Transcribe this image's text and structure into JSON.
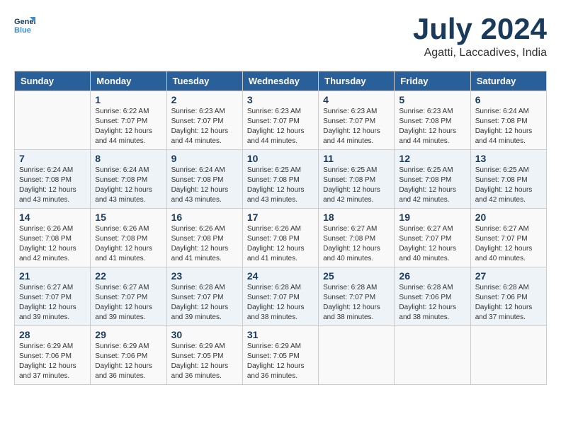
{
  "header": {
    "logo_line1": "General",
    "logo_line2": "Blue",
    "month_year": "July 2024",
    "subtitle": "Agatti, Laccadives, India"
  },
  "columns": [
    "Sunday",
    "Monday",
    "Tuesday",
    "Wednesday",
    "Thursday",
    "Friday",
    "Saturday"
  ],
  "weeks": [
    [
      {
        "day": "",
        "info": ""
      },
      {
        "day": "1",
        "info": "Sunrise: 6:22 AM\nSunset: 7:07 PM\nDaylight: 12 hours\nand 44 minutes."
      },
      {
        "day": "2",
        "info": "Sunrise: 6:23 AM\nSunset: 7:07 PM\nDaylight: 12 hours\nand 44 minutes."
      },
      {
        "day": "3",
        "info": "Sunrise: 6:23 AM\nSunset: 7:07 PM\nDaylight: 12 hours\nand 44 minutes."
      },
      {
        "day": "4",
        "info": "Sunrise: 6:23 AM\nSunset: 7:07 PM\nDaylight: 12 hours\nand 44 minutes."
      },
      {
        "day": "5",
        "info": "Sunrise: 6:23 AM\nSunset: 7:08 PM\nDaylight: 12 hours\nand 44 minutes."
      },
      {
        "day": "6",
        "info": "Sunrise: 6:24 AM\nSunset: 7:08 PM\nDaylight: 12 hours\nand 44 minutes."
      }
    ],
    [
      {
        "day": "7",
        "info": "Sunrise: 6:24 AM\nSunset: 7:08 PM\nDaylight: 12 hours\nand 43 minutes."
      },
      {
        "day": "8",
        "info": "Sunrise: 6:24 AM\nSunset: 7:08 PM\nDaylight: 12 hours\nand 43 minutes."
      },
      {
        "day": "9",
        "info": "Sunrise: 6:24 AM\nSunset: 7:08 PM\nDaylight: 12 hours\nand 43 minutes."
      },
      {
        "day": "10",
        "info": "Sunrise: 6:25 AM\nSunset: 7:08 PM\nDaylight: 12 hours\nand 43 minutes."
      },
      {
        "day": "11",
        "info": "Sunrise: 6:25 AM\nSunset: 7:08 PM\nDaylight: 12 hours\nand 42 minutes."
      },
      {
        "day": "12",
        "info": "Sunrise: 6:25 AM\nSunset: 7:08 PM\nDaylight: 12 hours\nand 42 minutes."
      },
      {
        "day": "13",
        "info": "Sunrise: 6:25 AM\nSunset: 7:08 PM\nDaylight: 12 hours\nand 42 minutes."
      }
    ],
    [
      {
        "day": "14",
        "info": "Sunrise: 6:26 AM\nSunset: 7:08 PM\nDaylight: 12 hours\nand 42 minutes."
      },
      {
        "day": "15",
        "info": "Sunrise: 6:26 AM\nSunset: 7:08 PM\nDaylight: 12 hours\nand 41 minutes."
      },
      {
        "day": "16",
        "info": "Sunrise: 6:26 AM\nSunset: 7:08 PM\nDaylight: 12 hours\nand 41 minutes."
      },
      {
        "day": "17",
        "info": "Sunrise: 6:26 AM\nSunset: 7:08 PM\nDaylight: 12 hours\nand 41 minutes."
      },
      {
        "day": "18",
        "info": "Sunrise: 6:27 AM\nSunset: 7:08 PM\nDaylight: 12 hours\nand 40 minutes."
      },
      {
        "day": "19",
        "info": "Sunrise: 6:27 AM\nSunset: 7:07 PM\nDaylight: 12 hours\nand 40 minutes."
      },
      {
        "day": "20",
        "info": "Sunrise: 6:27 AM\nSunset: 7:07 PM\nDaylight: 12 hours\nand 40 minutes."
      }
    ],
    [
      {
        "day": "21",
        "info": "Sunrise: 6:27 AM\nSunset: 7:07 PM\nDaylight: 12 hours\nand 39 minutes."
      },
      {
        "day": "22",
        "info": "Sunrise: 6:27 AM\nSunset: 7:07 PM\nDaylight: 12 hours\nand 39 minutes."
      },
      {
        "day": "23",
        "info": "Sunrise: 6:28 AM\nSunset: 7:07 PM\nDaylight: 12 hours\nand 39 minutes."
      },
      {
        "day": "24",
        "info": "Sunrise: 6:28 AM\nSunset: 7:07 PM\nDaylight: 12 hours\nand 38 minutes."
      },
      {
        "day": "25",
        "info": "Sunrise: 6:28 AM\nSunset: 7:07 PM\nDaylight: 12 hours\nand 38 minutes."
      },
      {
        "day": "26",
        "info": "Sunrise: 6:28 AM\nSunset: 7:06 PM\nDaylight: 12 hours\nand 38 minutes."
      },
      {
        "day": "27",
        "info": "Sunrise: 6:28 AM\nSunset: 7:06 PM\nDaylight: 12 hours\nand 37 minutes."
      }
    ],
    [
      {
        "day": "28",
        "info": "Sunrise: 6:29 AM\nSunset: 7:06 PM\nDaylight: 12 hours\nand 37 minutes."
      },
      {
        "day": "29",
        "info": "Sunrise: 6:29 AM\nSunset: 7:06 PM\nDaylight: 12 hours\nand 36 minutes."
      },
      {
        "day": "30",
        "info": "Sunrise: 6:29 AM\nSunset: 7:05 PM\nDaylight: 12 hours\nand 36 minutes."
      },
      {
        "day": "31",
        "info": "Sunrise: 6:29 AM\nSunset: 7:05 PM\nDaylight: 12 hours\nand 36 minutes."
      },
      {
        "day": "",
        "info": ""
      },
      {
        "day": "",
        "info": ""
      },
      {
        "day": "",
        "info": ""
      }
    ]
  ]
}
